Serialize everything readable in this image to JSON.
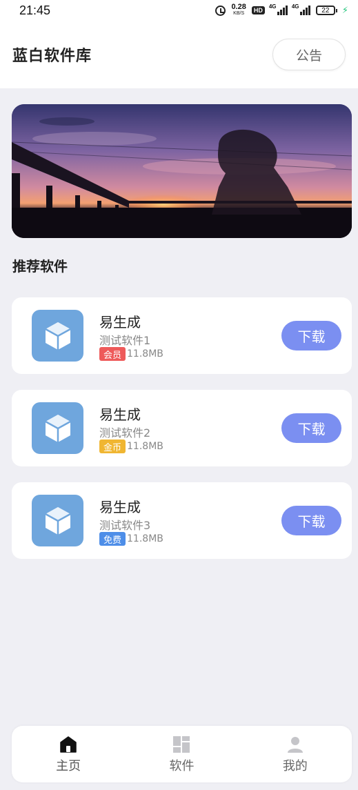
{
  "status_bar": {
    "time": "21:45",
    "net_speed": "0.28",
    "net_unit": "KB/S",
    "hd": "HD",
    "sig1": "4G",
    "sig2": "4G",
    "battery": "22"
  },
  "header": {
    "title": "蓝白软件库",
    "notice_label": "公告"
  },
  "section_title": "推荐软件",
  "apps": [
    {
      "name": "易生成",
      "desc": "测试软件1",
      "badge": "会员",
      "badge_color": "#ee5a5a",
      "size": "11.8MB",
      "download": "下载"
    },
    {
      "name": "易生成",
      "desc": "测试软件2",
      "badge": "金币",
      "badge_color": "#f0b632",
      "size": "11.8MB",
      "download": "下载"
    },
    {
      "name": "易生成",
      "desc": "测试软件3",
      "badge": "免费",
      "badge_color": "#4e8ee8",
      "size": "11.8MB",
      "download": "下载"
    }
  ],
  "bottom_nav": [
    {
      "label": "主页",
      "icon": "home-icon",
      "active": true
    },
    {
      "label": "软件",
      "icon": "grid-icon",
      "active": false
    },
    {
      "label": "我的",
      "icon": "user-icon",
      "active": false
    }
  ],
  "colors": {
    "accent": "#7b8ff1",
    "app_icon": "#6fa6dd",
    "background": "#efeff4"
  }
}
